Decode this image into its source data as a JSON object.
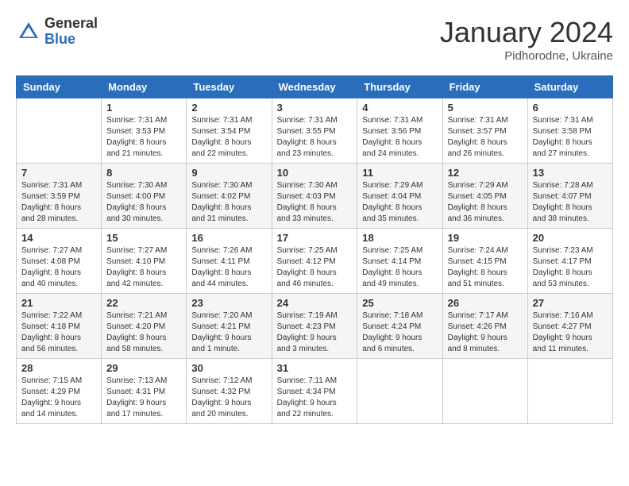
{
  "header": {
    "logo_general": "General",
    "logo_blue": "Blue",
    "month_title": "January 2024",
    "subtitle": "Pidhorodne, Ukraine"
  },
  "weekdays": [
    "Sunday",
    "Monday",
    "Tuesday",
    "Wednesday",
    "Thursday",
    "Friday",
    "Saturday"
  ],
  "weeks": [
    [
      {
        "day": "",
        "info": ""
      },
      {
        "day": "1",
        "info": "Sunrise: 7:31 AM\nSunset: 3:53 PM\nDaylight: 8 hours\nand 21 minutes."
      },
      {
        "day": "2",
        "info": "Sunrise: 7:31 AM\nSunset: 3:54 PM\nDaylight: 8 hours\nand 22 minutes."
      },
      {
        "day": "3",
        "info": "Sunrise: 7:31 AM\nSunset: 3:55 PM\nDaylight: 8 hours\nand 23 minutes."
      },
      {
        "day": "4",
        "info": "Sunrise: 7:31 AM\nSunset: 3:56 PM\nDaylight: 8 hours\nand 24 minutes."
      },
      {
        "day": "5",
        "info": "Sunrise: 7:31 AM\nSunset: 3:57 PM\nDaylight: 8 hours\nand 26 minutes."
      },
      {
        "day": "6",
        "info": "Sunrise: 7:31 AM\nSunset: 3:58 PM\nDaylight: 8 hours\nand 27 minutes."
      }
    ],
    [
      {
        "day": "7",
        "info": "Sunrise: 7:31 AM\nSunset: 3:59 PM\nDaylight: 8 hours\nand 28 minutes."
      },
      {
        "day": "8",
        "info": "Sunrise: 7:30 AM\nSunset: 4:00 PM\nDaylight: 8 hours\nand 30 minutes."
      },
      {
        "day": "9",
        "info": "Sunrise: 7:30 AM\nSunset: 4:02 PM\nDaylight: 8 hours\nand 31 minutes."
      },
      {
        "day": "10",
        "info": "Sunrise: 7:30 AM\nSunset: 4:03 PM\nDaylight: 8 hours\nand 33 minutes."
      },
      {
        "day": "11",
        "info": "Sunrise: 7:29 AM\nSunset: 4:04 PM\nDaylight: 8 hours\nand 35 minutes."
      },
      {
        "day": "12",
        "info": "Sunrise: 7:29 AM\nSunset: 4:05 PM\nDaylight: 8 hours\nand 36 minutes."
      },
      {
        "day": "13",
        "info": "Sunrise: 7:28 AM\nSunset: 4:07 PM\nDaylight: 8 hours\nand 38 minutes."
      }
    ],
    [
      {
        "day": "14",
        "info": "Sunrise: 7:27 AM\nSunset: 4:08 PM\nDaylight: 8 hours\nand 40 minutes."
      },
      {
        "day": "15",
        "info": "Sunrise: 7:27 AM\nSunset: 4:10 PM\nDaylight: 8 hours\nand 42 minutes."
      },
      {
        "day": "16",
        "info": "Sunrise: 7:26 AM\nSunset: 4:11 PM\nDaylight: 8 hours\nand 44 minutes."
      },
      {
        "day": "17",
        "info": "Sunrise: 7:25 AM\nSunset: 4:12 PM\nDaylight: 8 hours\nand 46 minutes."
      },
      {
        "day": "18",
        "info": "Sunrise: 7:25 AM\nSunset: 4:14 PM\nDaylight: 8 hours\nand 49 minutes."
      },
      {
        "day": "19",
        "info": "Sunrise: 7:24 AM\nSunset: 4:15 PM\nDaylight: 8 hours\nand 51 minutes."
      },
      {
        "day": "20",
        "info": "Sunrise: 7:23 AM\nSunset: 4:17 PM\nDaylight: 8 hours\nand 53 minutes."
      }
    ],
    [
      {
        "day": "21",
        "info": "Sunrise: 7:22 AM\nSunset: 4:18 PM\nDaylight: 8 hours\nand 56 minutes."
      },
      {
        "day": "22",
        "info": "Sunrise: 7:21 AM\nSunset: 4:20 PM\nDaylight: 8 hours\nand 58 minutes."
      },
      {
        "day": "23",
        "info": "Sunrise: 7:20 AM\nSunset: 4:21 PM\nDaylight: 9 hours\nand 1 minute."
      },
      {
        "day": "24",
        "info": "Sunrise: 7:19 AM\nSunset: 4:23 PM\nDaylight: 9 hours\nand 3 minutes."
      },
      {
        "day": "25",
        "info": "Sunrise: 7:18 AM\nSunset: 4:24 PM\nDaylight: 9 hours\nand 6 minutes."
      },
      {
        "day": "26",
        "info": "Sunrise: 7:17 AM\nSunset: 4:26 PM\nDaylight: 9 hours\nand 8 minutes."
      },
      {
        "day": "27",
        "info": "Sunrise: 7:16 AM\nSunset: 4:27 PM\nDaylight: 9 hours\nand 11 minutes."
      }
    ],
    [
      {
        "day": "28",
        "info": "Sunrise: 7:15 AM\nSunset: 4:29 PM\nDaylight: 9 hours\nand 14 minutes."
      },
      {
        "day": "29",
        "info": "Sunrise: 7:13 AM\nSunset: 4:31 PM\nDaylight: 9 hours\nand 17 minutes."
      },
      {
        "day": "30",
        "info": "Sunrise: 7:12 AM\nSunset: 4:32 PM\nDaylight: 9 hours\nand 20 minutes."
      },
      {
        "day": "31",
        "info": "Sunrise: 7:11 AM\nSunset: 4:34 PM\nDaylight: 9 hours\nand 22 minutes."
      },
      {
        "day": "",
        "info": ""
      },
      {
        "day": "",
        "info": ""
      },
      {
        "day": "",
        "info": ""
      }
    ]
  ]
}
